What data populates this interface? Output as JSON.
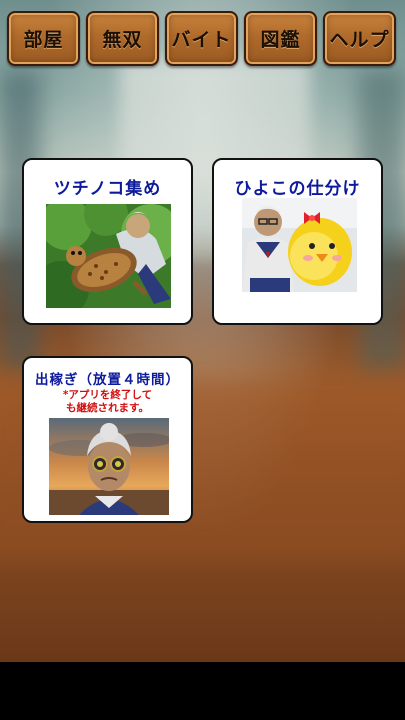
{
  "nav": {
    "buttons": [
      {
        "label": "部屋"
      },
      {
        "label": "無双"
      },
      {
        "label": "バイト"
      },
      {
        "label": "図鑑"
      },
      {
        "label": "ヘルプ"
      }
    ]
  },
  "jobs": {
    "tsuchinoko": {
      "title": "ツチノコ集め"
    },
    "hiyoko": {
      "title": "ひよこの仕分け"
    },
    "dekasegi": {
      "title": "出稼ぎ（放置４時間）",
      "note_line1": "*アプリを終了して",
      "note_line2": "も継続されます。"
    }
  },
  "colors": {
    "nav_button": "#b06b2c",
    "card_title": "#0d1a9c",
    "card_note": "#d01010"
  }
}
